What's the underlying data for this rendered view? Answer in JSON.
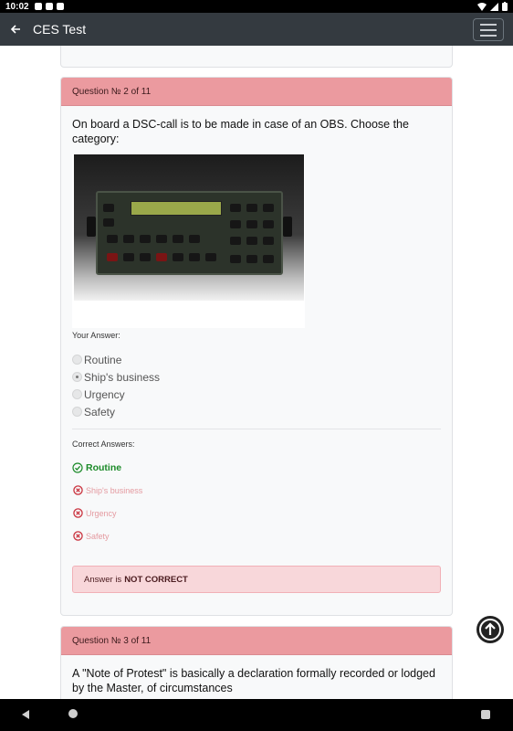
{
  "status_bar": {
    "time": "10:02"
  },
  "app_bar": {
    "title": "CES Test"
  },
  "question2": {
    "header": "Question № 2 of 11",
    "text": "On board a DSC-call is to be made in case of an OBS. Choose the category:",
    "your_answer_label": "Your Answer:",
    "options": [
      "Routine",
      "Ship's business",
      "Urgency",
      "Safety"
    ],
    "selected_option": "Ship's business",
    "correct_answers_label": "Correct Answers:",
    "correct_answer": "Routine",
    "wrong_answers": [
      "Ship's business",
      "Urgency",
      "Safety"
    ],
    "result_prefix": "Answer is",
    "result_status": "NOT CORRECT"
  },
  "question3": {
    "header": "Question № 3 of 11",
    "text": "A \"Note of Protest\" is basically a declaration formally recorded or lodged by the Master, of circumstances"
  },
  "colors": {
    "header_bg": "#eb9a9f",
    "appbar_bg": "#343a40",
    "correct_green": "#1b8a28",
    "wrong_red": "#e49aa0",
    "alert_bg": "#f8d7da"
  },
  "icons": {
    "back": "arrow-left-icon",
    "menu": "hamburger-menu-icon",
    "correct": "check-circle-icon",
    "wrong": "x-circle-icon",
    "scroll_top": "arrow-up-circle-icon"
  }
}
